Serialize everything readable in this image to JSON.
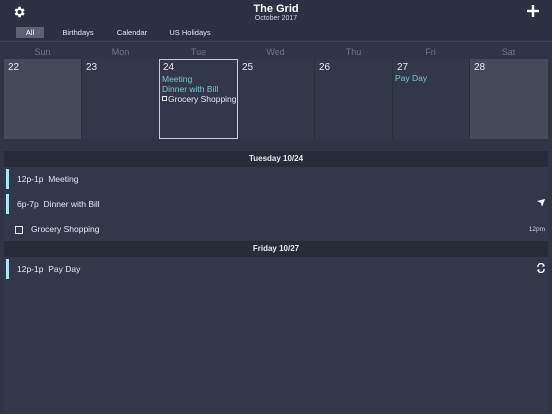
{
  "header": {
    "title": "The Grid",
    "subtitle": "October 2017",
    "settings_icon": "gear-icon",
    "add_icon": "plus-icon"
  },
  "filters": [
    {
      "label": "All",
      "active": true
    },
    {
      "label": "Birthdays",
      "active": false
    },
    {
      "label": "Calendar",
      "active": false
    },
    {
      "label": "US Holidays",
      "active": false
    }
  ],
  "week": {
    "day_names": [
      "Sun",
      "Mon",
      "Tue",
      "Wed",
      "Thu",
      "Fri",
      "Sat"
    ],
    "days": [
      {
        "num": "22",
        "events": []
      },
      {
        "num": "23",
        "events": []
      },
      {
        "num": "24",
        "events": [
          "Meeting",
          "Dinner with Bill",
          "Grocery Shopping"
        ]
      },
      {
        "num": "25",
        "events": []
      },
      {
        "num": "26",
        "events": []
      },
      {
        "num": "27",
        "events": [
          "Pay Day"
        ]
      },
      {
        "num": "28",
        "events": []
      }
    ]
  },
  "agenda": [
    {
      "date": "Tuesday 10/24",
      "items": [
        {
          "time": "12p-1p",
          "title": "Meeting",
          "type": "event"
        },
        {
          "time": "6p-7p",
          "title": "Dinner with Bill",
          "type": "event",
          "icon": "location-arrow-icon"
        },
        {
          "title": "Grocery Shopping",
          "type": "todo",
          "due": "12pm"
        }
      ]
    },
    {
      "date": "Friday 10/27",
      "items": [
        {
          "time": "12p-1p",
          "title": "Pay Day",
          "type": "event",
          "icon": "repeat-icon"
        }
      ]
    }
  ],
  "colors": {
    "background": "#2f3544",
    "accent": "#79c7dd",
    "event_bar": "#a9e5f3"
  }
}
